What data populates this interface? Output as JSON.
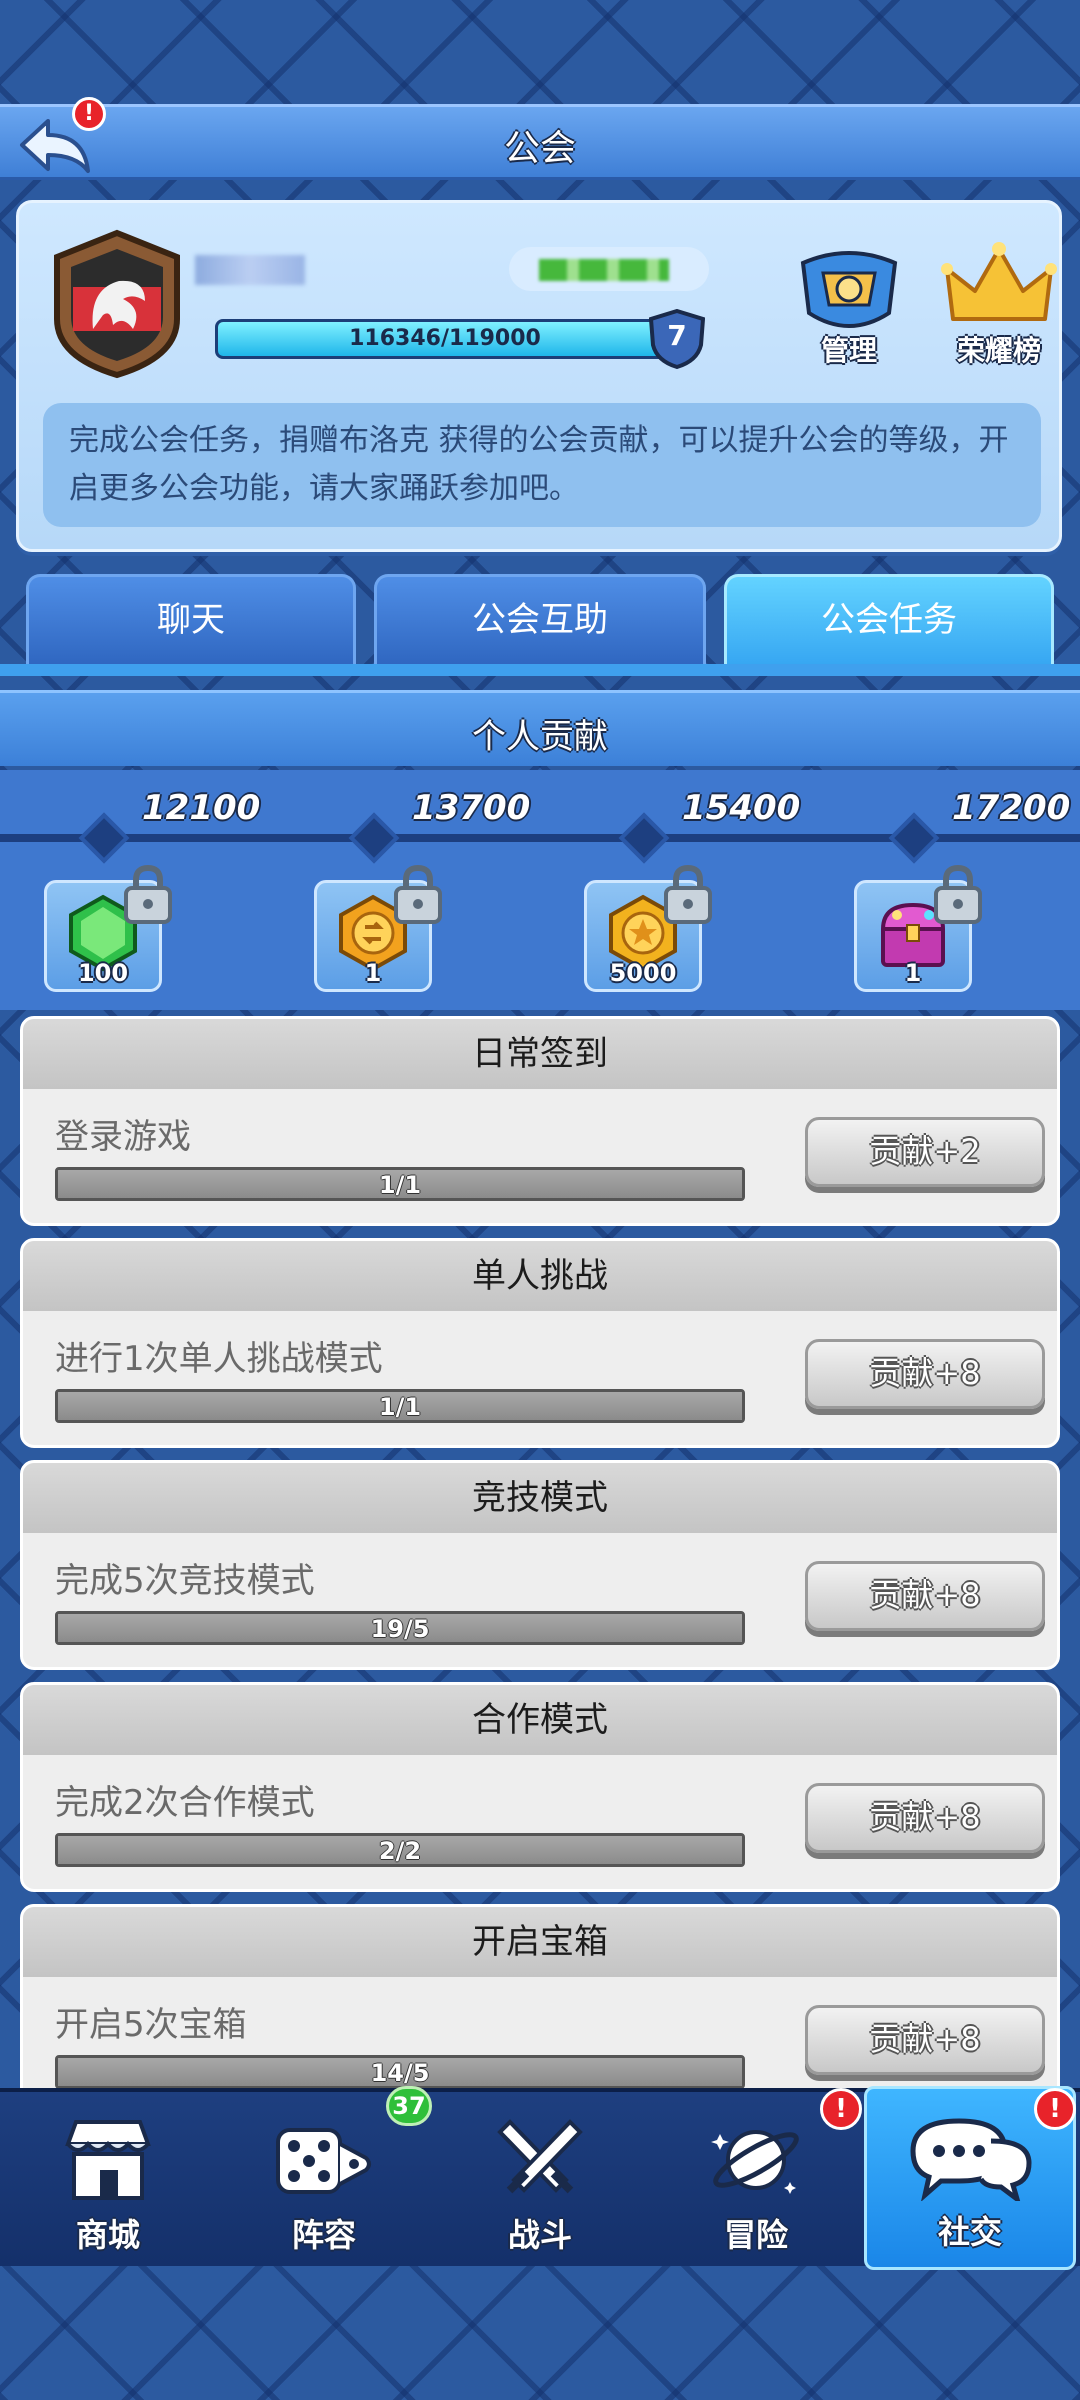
{
  "header": {
    "title": "公会",
    "back_alert": "!"
  },
  "guild": {
    "exp_text": "116346/119000",
    "exp_progress": 0.978,
    "level": "7",
    "manage_label": "管理",
    "honor_label": "荣耀榜",
    "description": "完成公会任务，捐赠布洛克  获得的公会贡献，可以提升公会的等级，开启更多公会功能，请大家踊跃参加吧。"
  },
  "tabs": [
    {
      "label": "聊天",
      "active": false
    },
    {
      "label": "公会互助",
      "active": false
    },
    {
      "label": "公会任务",
      "active": true
    }
  ],
  "contribution": {
    "title": "个人贡献",
    "milestones": [
      "12100",
      "13700",
      "15400",
      "17200"
    ],
    "rewards": [
      {
        "icon": "gem-icon",
        "count": "100",
        "locked": true
      },
      {
        "icon": "swap-coin-icon",
        "count": "1",
        "locked": true
      },
      {
        "icon": "gold-coin-icon",
        "count": "5000",
        "locked": true
      },
      {
        "icon": "treasure-chest-icon",
        "count": "1",
        "locked": true
      }
    ]
  },
  "tasks": [
    {
      "title": "日常签到",
      "desc": "登录游戏",
      "progress_text": "1/1",
      "progress": 1.0,
      "button": "贡献+2"
    },
    {
      "title": "单人挑战",
      "desc": "进行1次单人挑战模式",
      "progress_text": "1/1",
      "progress": 1.0,
      "button": "贡献+8"
    },
    {
      "title": "竞技模式",
      "desc": "完成5次竞技模式",
      "progress_text": "19/5",
      "progress": 1.0,
      "button": "贡献+8"
    },
    {
      "title": "合作模式",
      "desc": "完成2次合作模式",
      "progress_text": "2/2",
      "progress": 1.0,
      "button": "贡献+8"
    },
    {
      "title": "开启宝箱",
      "desc": "开启5次宝箱",
      "progress_text": "14/5",
      "progress": 1.0,
      "button": "贡献+8"
    }
  ],
  "nav": [
    {
      "label": "商城",
      "icon": "shop-icon"
    },
    {
      "label": "阵容",
      "icon": "dice-icon",
      "badge": "37"
    },
    {
      "label": "战斗",
      "icon": "crossed-swords-icon"
    },
    {
      "label": "冒险",
      "icon": "planet-icon",
      "alert": "!"
    },
    {
      "label": "社交",
      "icon": "chat-bubbles-icon",
      "alert": "!",
      "active": true
    }
  ],
  "colors": {
    "accent": "#36a6f2",
    "alert": "#e8232a",
    "badge": "#2fbf3a"
  }
}
